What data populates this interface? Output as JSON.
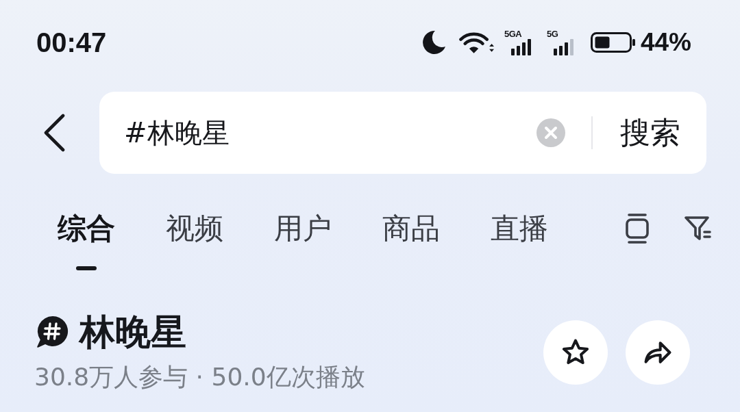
{
  "status_bar": {
    "time": "00:47",
    "signals": [
      {
        "label": "5GA"
      },
      {
        "label": "5G"
      }
    ],
    "battery": "44%"
  },
  "search": {
    "query": "#林晚星",
    "button": "搜索"
  },
  "tabs": [
    {
      "label": "综合",
      "selected": true
    },
    {
      "label": "视频",
      "selected": false
    },
    {
      "label": "用户",
      "selected": false
    },
    {
      "label": "商品",
      "selected": false
    },
    {
      "label": "直播",
      "selected": false
    }
  ],
  "topic": {
    "title": "林晚星",
    "stats": "30.8万人参与 · 50.0亿次播放"
  }
}
